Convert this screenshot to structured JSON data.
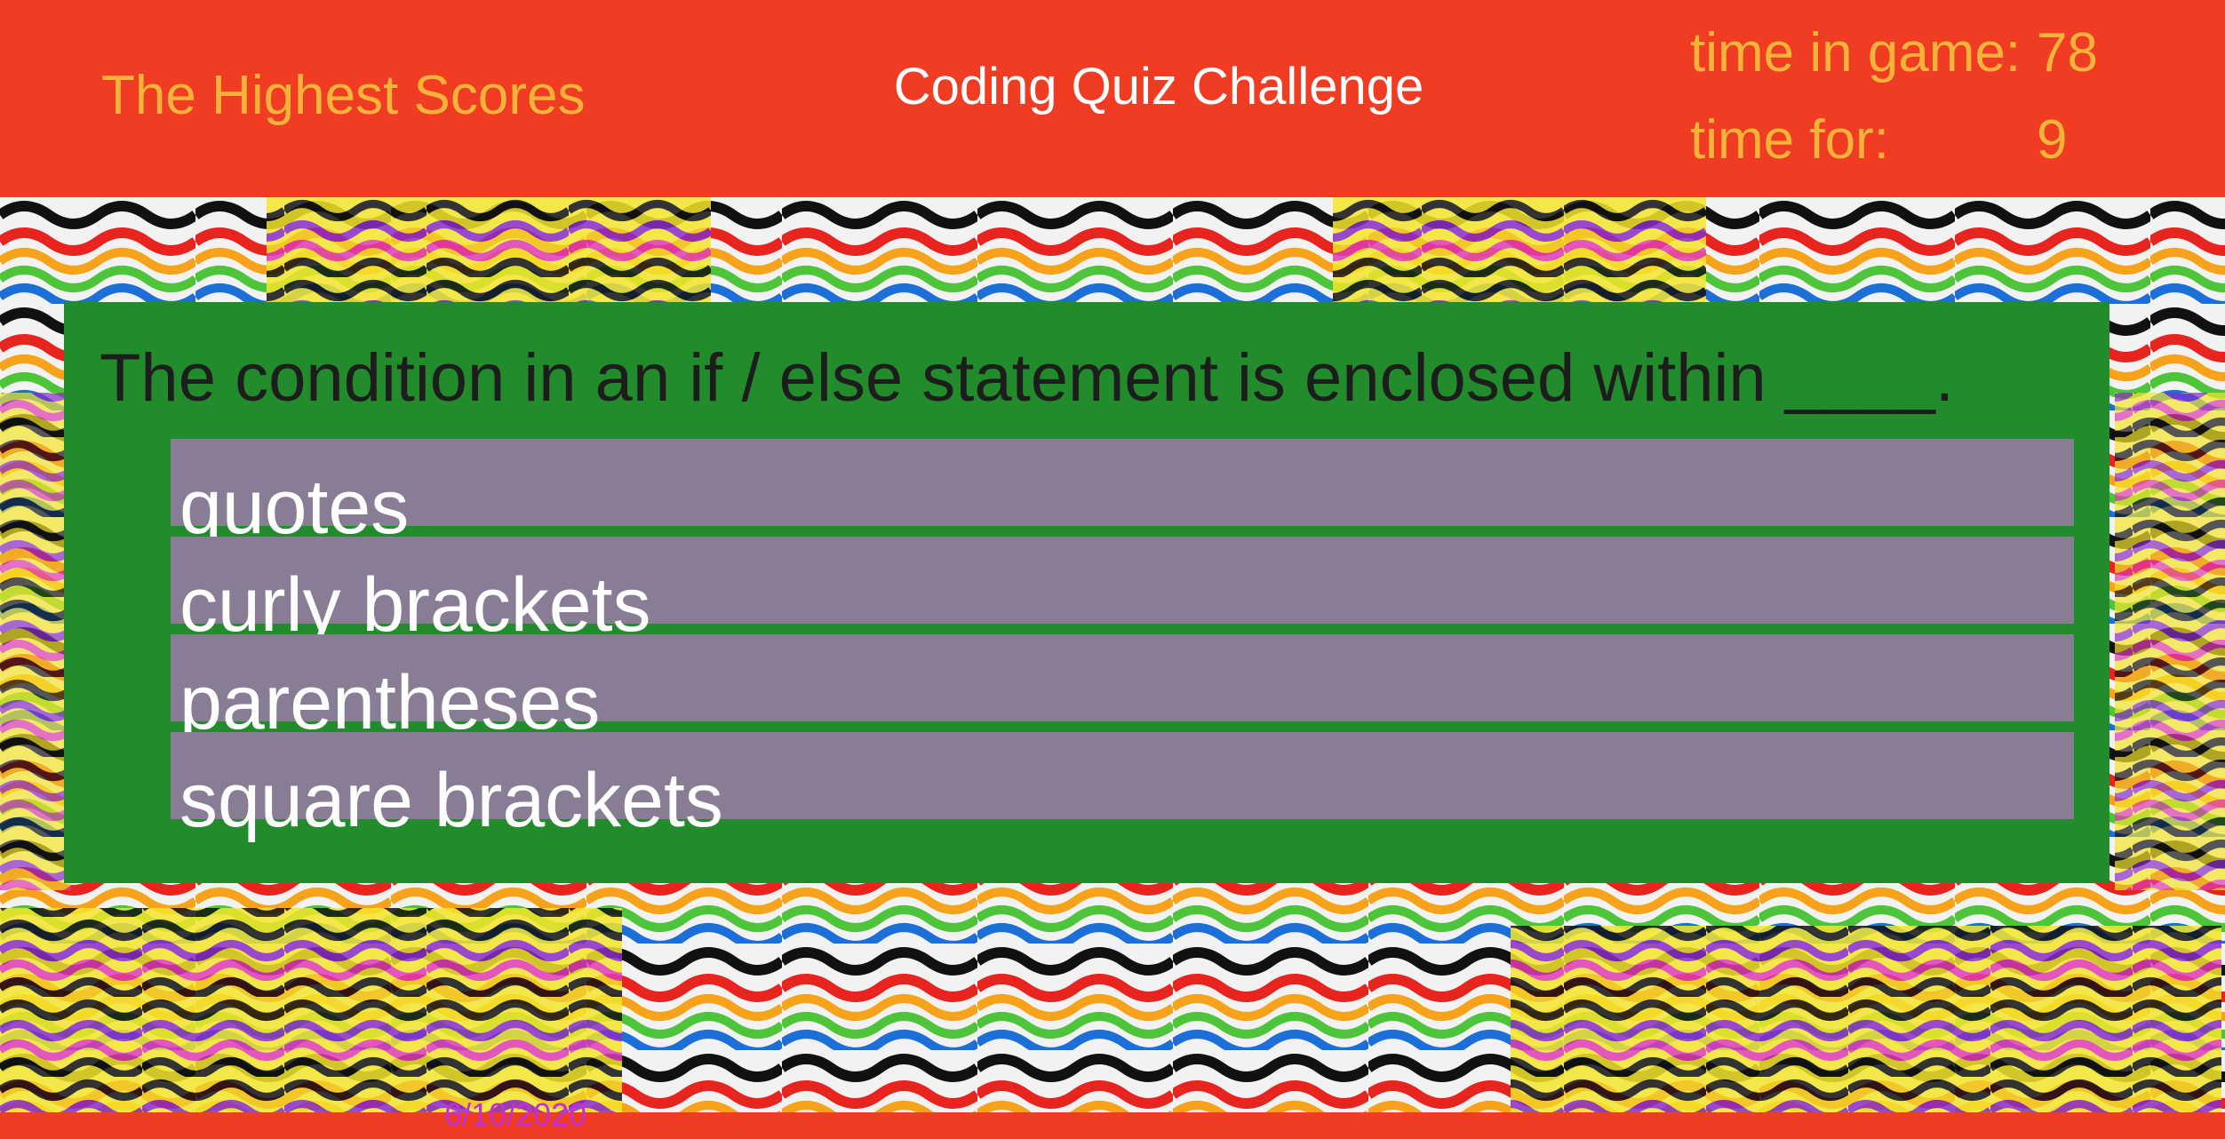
{
  "header": {
    "high_scores_link": "The Highest Scores",
    "title": "Coding Quiz Challenge",
    "time_in_game_label": "time in game:",
    "time_in_game_value": "78",
    "time_for_label": "time for:",
    "time_for_value": "9"
  },
  "quiz": {
    "question": "The condition in an if / else statement is enclosed within ____.",
    "answers": [
      "quotes",
      "curly brackets",
      "parentheses",
      "square brackets"
    ]
  },
  "footer": {
    "date": "6/10/2020"
  },
  "colors": {
    "header_bg": "#f03c22",
    "accent_text": "#f5b33a",
    "card_bg": "#228b2c",
    "answer_bg": "#887d95",
    "date_text": "#c52fd6"
  }
}
